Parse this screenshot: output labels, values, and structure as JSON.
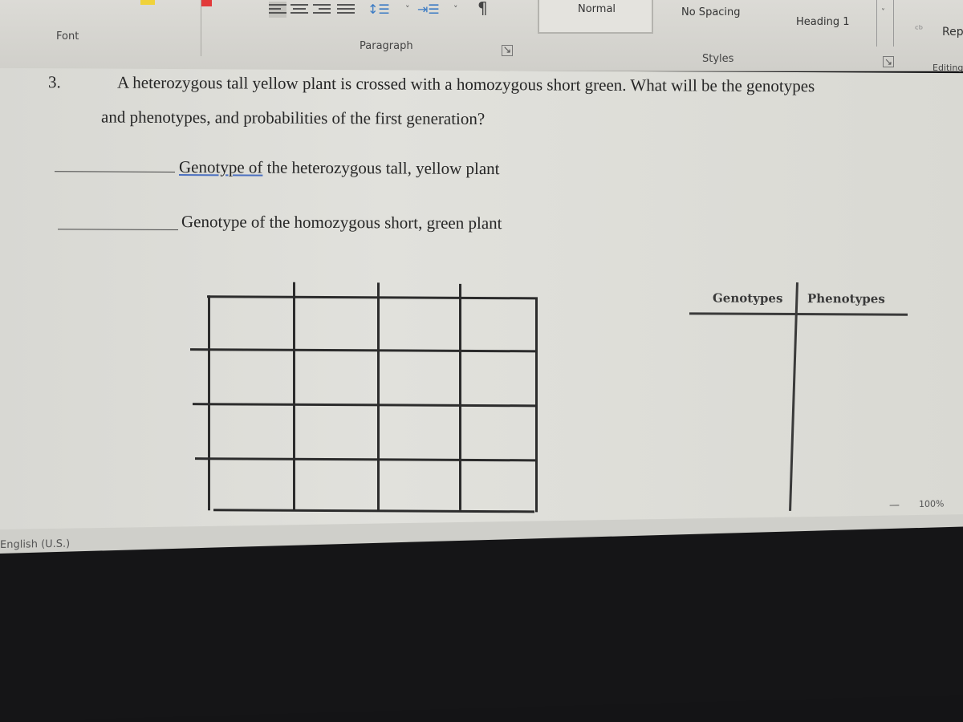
{
  "ribbon": {
    "groups": {
      "font": "Font",
      "paragraph": "Paragraph",
      "styles": "Styles",
      "editing": "Editing"
    },
    "paragraph_icons": [
      "align-left-icon",
      "align-center-icon",
      "align-right-icon",
      "justify-icon",
      "line-spacing-icon",
      "indent-icon",
      "pilcrow-icon"
    ],
    "pilcrow": "¶",
    "styles_gallery": [
      "Normal",
      "No Spacing",
      "Heading 1"
    ],
    "replace_label": "Rep",
    "dialog_launcher": "↘"
  },
  "document": {
    "question_number": "3.",
    "question_line1": "A heterozygous tall yellow plant is crossed with a homozygous short green.  What will be the genotypes",
    "question_line2": "and phenotypes, and probabilities of the first generation?",
    "prompt1_underlined": "Genotype  of",
    "prompt1_rest": " the heterozygous tall, yellow plant",
    "prompt2": "Genotype of the homozygous short, green plant",
    "punnett_square": {
      "rows": 4,
      "cols": 4
    },
    "tchart": {
      "headers": [
        "Genotypes",
        "Phenotypes"
      ]
    }
  },
  "statusbar": {
    "language": "English (U.S.)",
    "zoom": "100%",
    "zoom_out": "—"
  }
}
